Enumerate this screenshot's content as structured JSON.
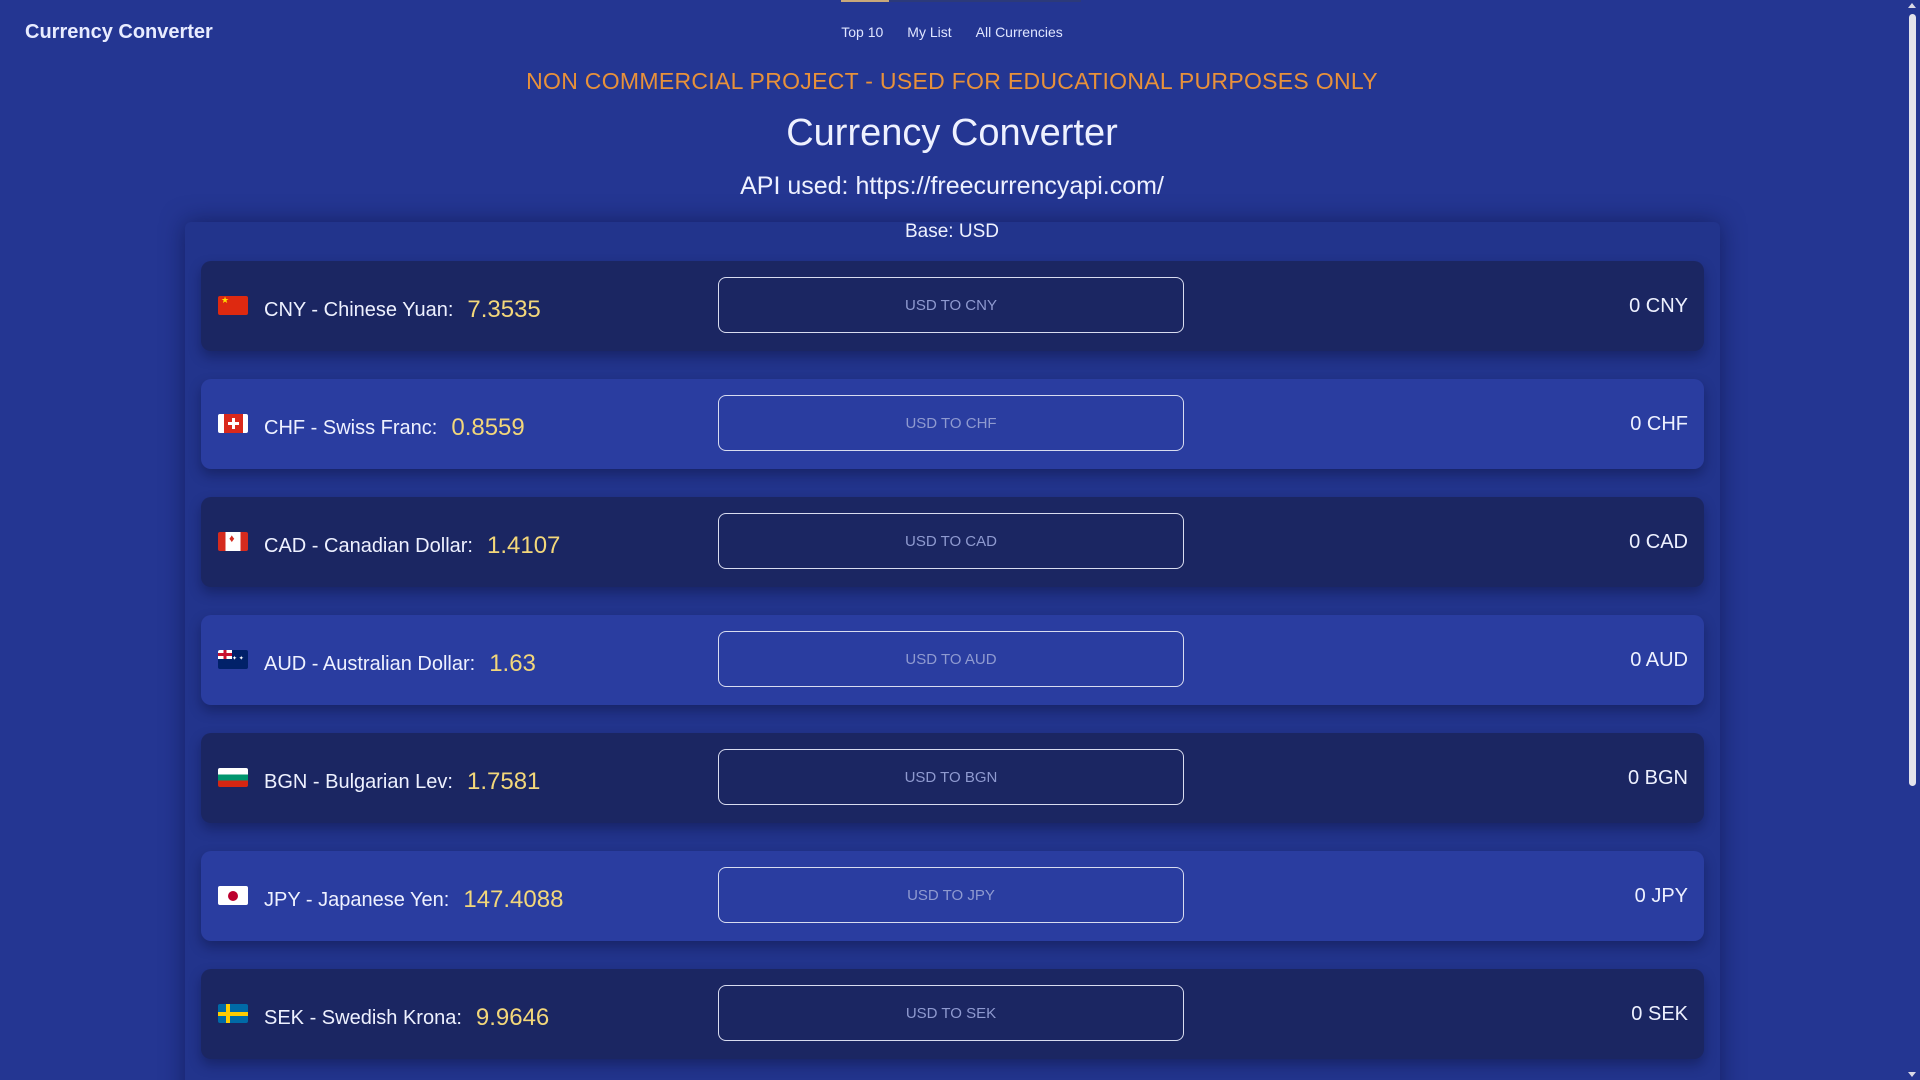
{
  "header": {
    "brand": "Currency Converter",
    "nav": [
      {
        "label": "Top 10"
      },
      {
        "label": "My List"
      },
      {
        "label": "All Currencies"
      }
    ]
  },
  "main": {
    "notice": "NON COMMERCIAL PROJECT - USED FOR EDUCATIONAL PURPOSES ONLY",
    "title": "Currency Converter",
    "api_line": "API used: https://freecurrencyapi.com/",
    "base_line": "Base: USD"
  },
  "currencies": [
    {
      "label": "CNY - Chinese Yuan:",
      "rate": "7.3535",
      "button": "USD TO CNY",
      "result": "0 CNY",
      "flag_icon": "china-flag-icon"
    },
    {
      "label": "CHF - Swiss Franc:",
      "rate": "0.8559",
      "button": "USD TO CHF",
      "result": "0 CHF",
      "flag_icon": "switzerland-flag-icon"
    },
    {
      "label": "CAD - Canadian Dollar:",
      "rate": "1.4107",
      "button": "USD TO CAD",
      "result": "0 CAD",
      "flag_icon": "canada-flag-icon"
    },
    {
      "label": "AUD - Australian Dollar:",
      "rate": "1.63",
      "button": "USD TO AUD",
      "result": "0 AUD",
      "flag_icon": "australia-flag-icon"
    },
    {
      "label": "BGN - Bulgarian Lev:",
      "rate": "1.7581",
      "button": "USD TO BGN",
      "result": "0 BGN",
      "flag_icon": "bulgaria-flag-icon"
    },
    {
      "label": "JPY - Japanese Yen:",
      "rate": "147.4088",
      "button": "USD TO JPY",
      "result": "0 JPY",
      "flag_icon": "japan-flag-icon"
    },
    {
      "label": "SEK - Swedish Krona:",
      "rate": "9.9646",
      "button": "USD TO SEK",
      "result": "0 SEK",
      "flag_icon": "sweden-flag-icon"
    }
  ],
  "colors": {
    "background": "#243692",
    "row_dark": "#1b2662",
    "row_light": "#2a3da0",
    "notice": "#e8913a",
    "rate": "#f3d77a",
    "nav_active_indicator": "#c9a87a"
  }
}
